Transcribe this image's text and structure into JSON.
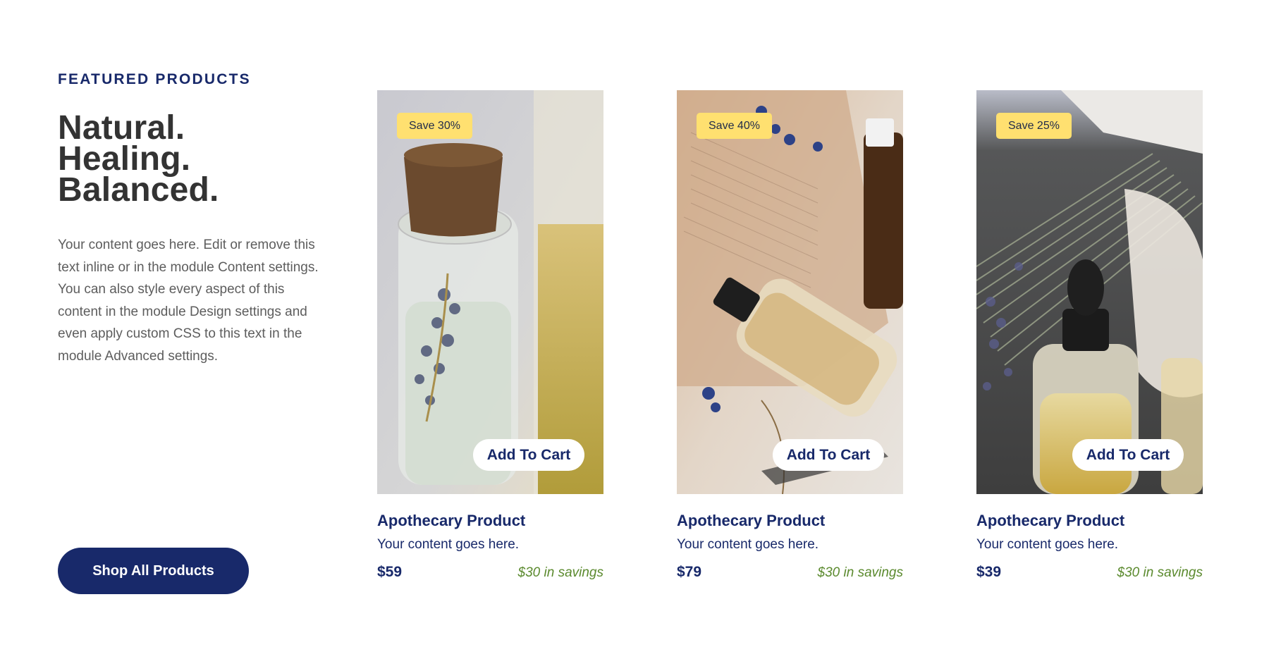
{
  "intro": {
    "eyebrow": "FEATURED PRODUCTS",
    "headline_line1": "Natural. Healing.",
    "headline_line2": "Balanced.",
    "body": "Your content goes here. Edit or remove this text inline or in the module Content settings. You can also style every aspect of this content in the module Design settings and even apply custom CSS to this text in the module Advanced settings.",
    "button_label": "Shop All Products"
  },
  "products": [
    {
      "badge": "Save 30%",
      "cart_label": "Add To Cart",
      "name": "Apothecary Product",
      "description": "Your content goes here.",
      "price": "$59",
      "savings": "$30 in savings"
    },
    {
      "badge": "Save 40%",
      "cart_label": "Add To Cart",
      "name": "Apothecary Product",
      "description": "Your content goes here.",
      "price": "$79",
      "savings": "$30 in savings"
    },
    {
      "badge": "Save 25%",
      "cart_label": "Add To Cart",
      "name": "Apothecary Product",
      "description": "Your content goes here.",
      "price": "$39",
      "savings": "$30 in savings"
    }
  ],
  "colors": {
    "brand_navy": "#18296a",
    "badge_yellow": "#ffe070",
    "savings_green": "#5b8a2e",
    "heading_gray": "#333333",
    "body_gray": "#5d5d5d"
  }
}
